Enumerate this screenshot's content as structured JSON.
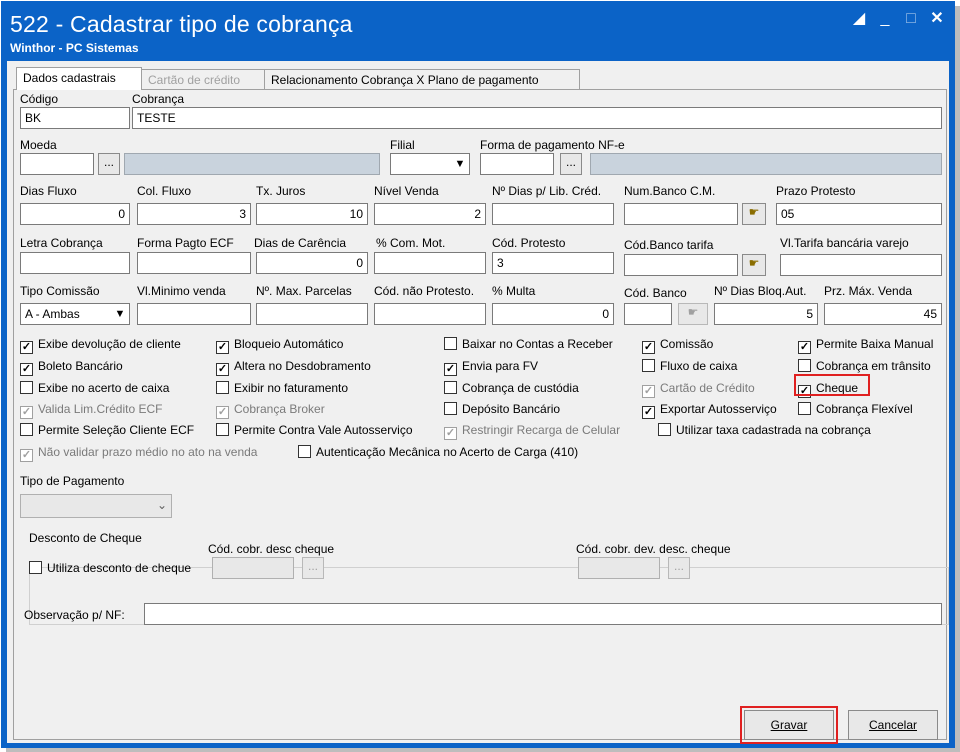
{
  "window": {
    "title": "522 - Cadastrar tipo de cobrança",
    "subtitle": "Winthor - PC Sistemas"
  },
  "tabs": [
    {
      "label": "Dados cadastrais",
      "state": "active"
    },
    {
      "label": "Cartão de crédito",
      "state": "disabled"
    },
    {
      "label": "Relacionamento Cobrança X Plano de pagamento",
      "state": "normal"
    }
  ],
  "form": {
    "codigo": {
      "label": "Código",
      "value": "BK"
    },
    "cobranca": {
      "label": "Cobrança",
      "value": "TESTE"
    },
    "moeda": {
      "label": "Moeda",
      "value": ""
    },
    "filial": {
      "label": "Filial",
      "value": ""
    },
    "forma_pagamento_nfe": {
      "label": "Forma de pagamento NF-e",
      "value": ""
    },
    "dias_fluxo": {
      "label": "Dias Fluxo",
      "value": "0"
    },
    "col_fluxo": {
      "label": "Col. Fluxo",
      "value": "3"
    },
    "tx_juros": {
      "label": "Tx. Juros",
      "value": "10"
    },
    "nivel_venda": {
      "label": "Nível Venda",
      "value": "2"
    },
    "dias_lib_cred": {
      "label": "Nº Dias p/ Lib. Créd.",
      "value": ""
    },
    "num_banco_cm": {
      "label": "Num.Banco C.M.",
      "value": ""
    },
    "prazo_protesto": {
      "label": "Prazo Protesto",
      "value": "05"
    },
    "letra_cobranca": {
      "label": "Letra Cobrança",
      "value": ""
    },
    "forma_pagto_ecf": {
      "label": "Forma Pagto ECF",
      "value": ""
    },
    "dias_carencia": {
      "label": "Dias de Carência",
      "value": "0"
    },
    "com_mot": {
      "label": "% Com. Mot.",
      "value": ""
    },
    "cod_protesto": {
      "label": "Cód. Protesto",
      "value": "3"
    },
    "cod_banco_tarifa": {
      "label": "Cód.Banco tarifa",
      "value": ""
    },
    "vl_tarifa_bancaria": {
      "label": "Vl.Tarifa bancária varejo",
      "value": ""
    },
    "tipo_comissao": {
      "label": "Tipo Comissão",
      "value": "A - Ambas"
    },
    "vl_minimo_venda": {
      "label": "Vl.Minimo venda",
      "value": ""
    },
    "max_parcelas": {
      "label": "Nº. Max. Parcelas",
      "value": ""
    },
    "cod_nao_protesto": {
      "label": "Cód. não Protesto.",
      "value": ""
    },
    "multa": {
      "label": "% Multa",
      "value": "0"
    },
    "cod_banco": {
      "label": "Cód. Banco",
      "value": ""
    },
    "dias_bloq_aut": {
      "label": "Nº Dias Bloq.Aut.",
      "value": "5"
    },
    "prz_max_venda": {
      "label": "Prz. Máx. Venda",
      "value": "45"
    },
    "tipo_pagamento": {
      "label": "Tipo de Pagamento",
      "value": ""
    },
    "observacao_nf": {
      "label": "Observação p/ NF:",
      "value": ""
    }
  },
  "ellipsis": "...",
  "checkboxes": [
    {
      "label": "Exibe devolução de cliente",
      "checked": true,
      "disabled": false
    },
    {
      "label": "Boleto Bancário",
      "checked": true,
      "disabled": false
    },
    {
      "label": "Exibe no acerto de caixa",
      "checked": false,
      "disabled": false
    },
    {
      "label": "Valida Lim.Crédito ECF",
      "checked": true,
      "disabled": true
    },
    {
      "label": "Permite Seleção Cliente ECF",
      "checked": false,
      "disabled": false
    },
    {
      "label": "Não validar prazo médio no ato na venda",
      "checked": true,
      "disabled": true
    },
    {
      "label": "Bloqueio Automático",
      "checked": true,
      "disabled": false
    },
    {
      "label": "Altera no Desdobramento",
      "checked": true,
      "disabled": false
    },
    {
      "label": "Exibir no faturamento",
      "checked": false,
      "disabled": false
    },
    {
      "label": "Cobrança Broker",
      "checked": true,
      "disabled": true
    },
    {
      "label": "Permite Contra Vale Autosserviço",
      "checked": false,
      "disabled": false
    },
    {
      "label": "Autenticação Mecânica no Acerto de Carga (410)",
      "checked": false,
      "disabled": false
    },
    {
      "label": "Baixar no Contas a Receber",
      "checked": false,
      "disabled": false
    },
    {
      "label": "Envia para FV",
      "checked": true,
      "disabled": false
    },
    {
      "label": "Cobrança de custódia",
      "checked": false,
      "disabled": false
    },
    {
      "label": "Depósito Bancário",
      "checked": false,
      "disabled": false
    },
    {
      "label": "Restringir Recarga de Celular",
      "checked": true,
      "disabled": true
    },
    {
      "label": "Comissão",
      "checked": true,
      "disabled": false
    },
    {
      "label": "Fluxo de caixa",
      "checked": false,
      "disabled": false
    },
    {
      "label": "Cartão de Crédito",
      "checked": true,
      "disabled": true
    },
    {
      "label": "Exportar Autosserviço",
      "checked": true,
      "disabled": false
    },
    {
      "label": "Utilizar taxa cadastrada na cobrança",
      "checked": false,
      "disabled": false
    },
    {
      "label": "Permite Baixa Manual",
      "checked": true,
      "disabled": false
    },
    {
      "label": "Cobrança em trânsito",
      "checked": false,
      "disabled": false
    },
    {
      "label": "Cheque",
      "checked": true,
      "disabled": false
    },
    {
      "label": "Cobrança Flexível",
      "checked": false,
      "disabled": false
    }
  ],
  "desconto_cheque": {
    "group_label": "Desconto de Cheque",
    "utiliza_label": "Utiliza desconto de cheque",
    "utiliza_checked": false,
    "cod_desc_label": "Cód. cobr. desc cheque",
    "cod_dev_label": "Cód. cobr. dev. desc. cheque"
  },
  "buttons": {
    "gravar": "Gravar",
    "cancelar": "Cancelar"
  },
  "colors": {
    "titlebar": "#0b63c7",
    "highlight": "#e02020",
    "disabled_field": "#c9d3dd"
  }
}
